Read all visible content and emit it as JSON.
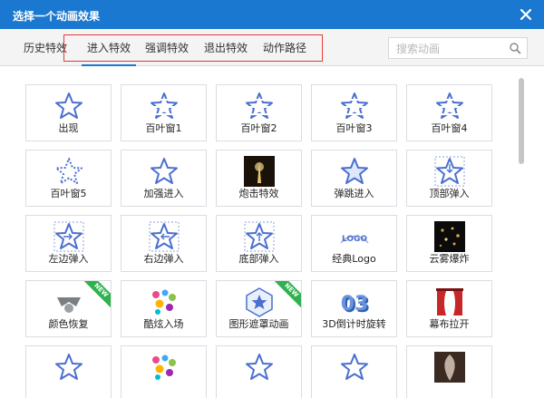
{
  "dialog": {
    "title": "选择一个动画效果",
    "close_icon": "close-icon"
  },
  "tabs": [
    {
      "label": "历史特效",
      "active": false
    },
    {
      "label": "进入特效",
      "active": true
    },
    {
      "label": "强调特效",
      "active": false
    },
    {
      "label": "退出特效",
      "active": false
    },
    {
      "label": "动作路径",
      "active": false
    }
  ],
  "search": {
    "placeholder": "搜索动画",
    "value": "",
    "icon": "search-icon"
  },
  "colors": {
    "accent": "#1a78d0",
    "highlight_box": "#e53935",
    "star_outline": "#4a6fd0",
    "new_badge": "#2fb14e"
  },
  "effects": [
    {
      "label": "出现",
      "icon": "star-outline-icon"
    },
    {
      "label": "百叶窗1",
      "icon": "star-blinds-icon"
    },
    {
      "label": "百叶窗2",
      "icon": "star-blinds-icon"
    },
    {
      "label": "百叶窗3",
      "icon": "star-blinds-icon"
    },
    {
      "label": "百叶窗4",
      "icon": "star-blinds-icon"
    },
    {
      "label": "百叶窗5",
      "icon": "star-dashed-icon"
    },
    {
      "label": "加强进入",
      "icon": "star-outline-icon"
    },
    {
      "label": "炮击特效",
      "icon": "firework-photo-icon"
    },
    {
      "label": "弹跳进入",
      "icon": "star-bounce-icon"
    },
    {
      "label": "顶部弹入",
      "icon": "star-arrow-down-icon"
    },
    {
      "label": "左边弹入",
      "icon": "star-arrow-right-icon"
    },
    {
      "label": "右边弹入",
      "icon": "star-arrow-left-icon"
    },
    {
      "label": "底部弹入",
      "icon": "star-arrow-up-icon"
    },
    {
      "label": "经典Logo",
      "icon": "logo-text-icon"
    },
    {
      "label": "云雾爆炸",
      "icon": "sparkle-photo-icon"
    },
    {
      "label": "颜色恢复",
      "icon": "star-gray-icon",
      "badge": "NEW"
    },
    {
      "label": "酷炫入场",
      "icon": "colorful-dots-icon"
    },
    {
      "label": "图形遮罩动画",
      "icon": "star-mask-icon",
      "badge": "NEW"
    },
    {
      "label": "3D倒计时旋转",
      "icon": "3d-number-icon",
      "icon_text": "03"
    },
    {
      "label": "幕布拉开",
      "icon": "curtain-icon"
    },
    {
      "label": "",
      "icon": "star-outline-icon"
    },
    {
      "label": "",
      "icon": "colorful-dots-icon"
    },
    {
      "label": "",
      "icon": "star-outline-icon"
    },
    {
      "label": "",
      "icon": "star-outline-icon"
    },
    {
      "label": "",
      "icon": "feather-photo-icon"
    }
  ]
}
